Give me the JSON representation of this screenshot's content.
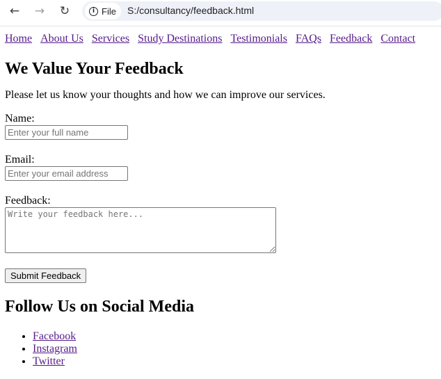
{
  "browser": {
    "back_icon": "←",
    "forward_icon": "→",
    "reload_icon": "↻",
    "chip_label": "File",
    "url": "S:/consultancy/feedback.html"
  },
  "nav": {
    "items": [
      "Home",
      "About Us",
      "Services",
      "Study Destinations",
      "Testimonials",
      "FAQs",
      "Feedback",
      "Contact"
    ]
  },
  "main": {
    "title": "We Value Your Feedback",
    "intro": "Please let us know your thoughts and how we can improve our services.",
    "form": {
      "name_label": "Name:",
      "name_placeholder": "Enter your full name",
      "email_label": "Email:",
      "email_placeholder": "Enter your email address",
      "feedback_label": "Feedback:",
      "feedback_placeholder": "Write your feedback here...",
      "submit_label": "Submit Feedback"
    }
  },
  "social": {
    "title": "Follow Us on Social Media",
    "links": [
      "Facebook",
      "Instagram",
      "Twitter"
    ]
  }
}
